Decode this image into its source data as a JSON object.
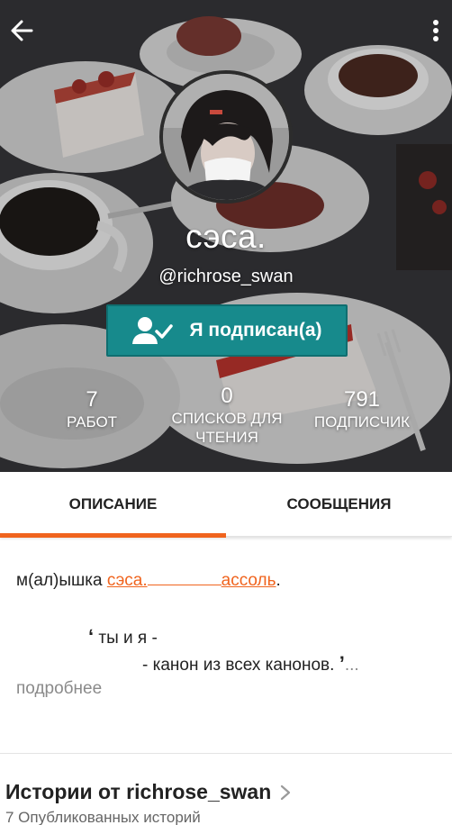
{
  "header": {
    "back_icon": "arrow-left-icon",
    "more_icon": "more-vertical-icon"
  },
  "profile": {
    "name": "сэса.",
    "handle": "@richrose_swan",
    "follow_button": {
      "label": "Я подписан(а)",
      "icon": "user-check-icon",
      "color": "#178a8c"
    },
    "stats": [
      {
        "value": "7",
        "label": "РАБОТ"
      },
      {
        "value": "0",
        "label": "СПИСКОВ ДЛЯ ЧТЕНИЯ"
      },
      {
        "value": "791",
        "label": "ПОДПИСЧИК"
      }
    ]
  },
  "tabs": {
    "items": [
      {
        "label": "ОПИСАНИЕ",
        "active": true
      },
      {
        "label": "СООБЩЕНИЯ",
        "active": false
      }
    ],
    "accent": "#f0641e"
  },
  "description": {
    "prefix": "м(ал)ышка",
    "link1": "сэса.",
    "link2": "ассоль",
    "suffix": ".",
    "quote_open": "ʻ",
    "quote_line1": "ты и я -",
    "quote_line2": "- канон из всех канонов.",
    "quote_close": "ʼ",
    "ellipsis": "...",
    "more": "подробнее"
  },
  "stories": {
    "title": "Истории от richrose_swan",
    "chevron_icon": "chevron-right-icon",
    "count_text": "7 Опубликованных историй"
  }
}
